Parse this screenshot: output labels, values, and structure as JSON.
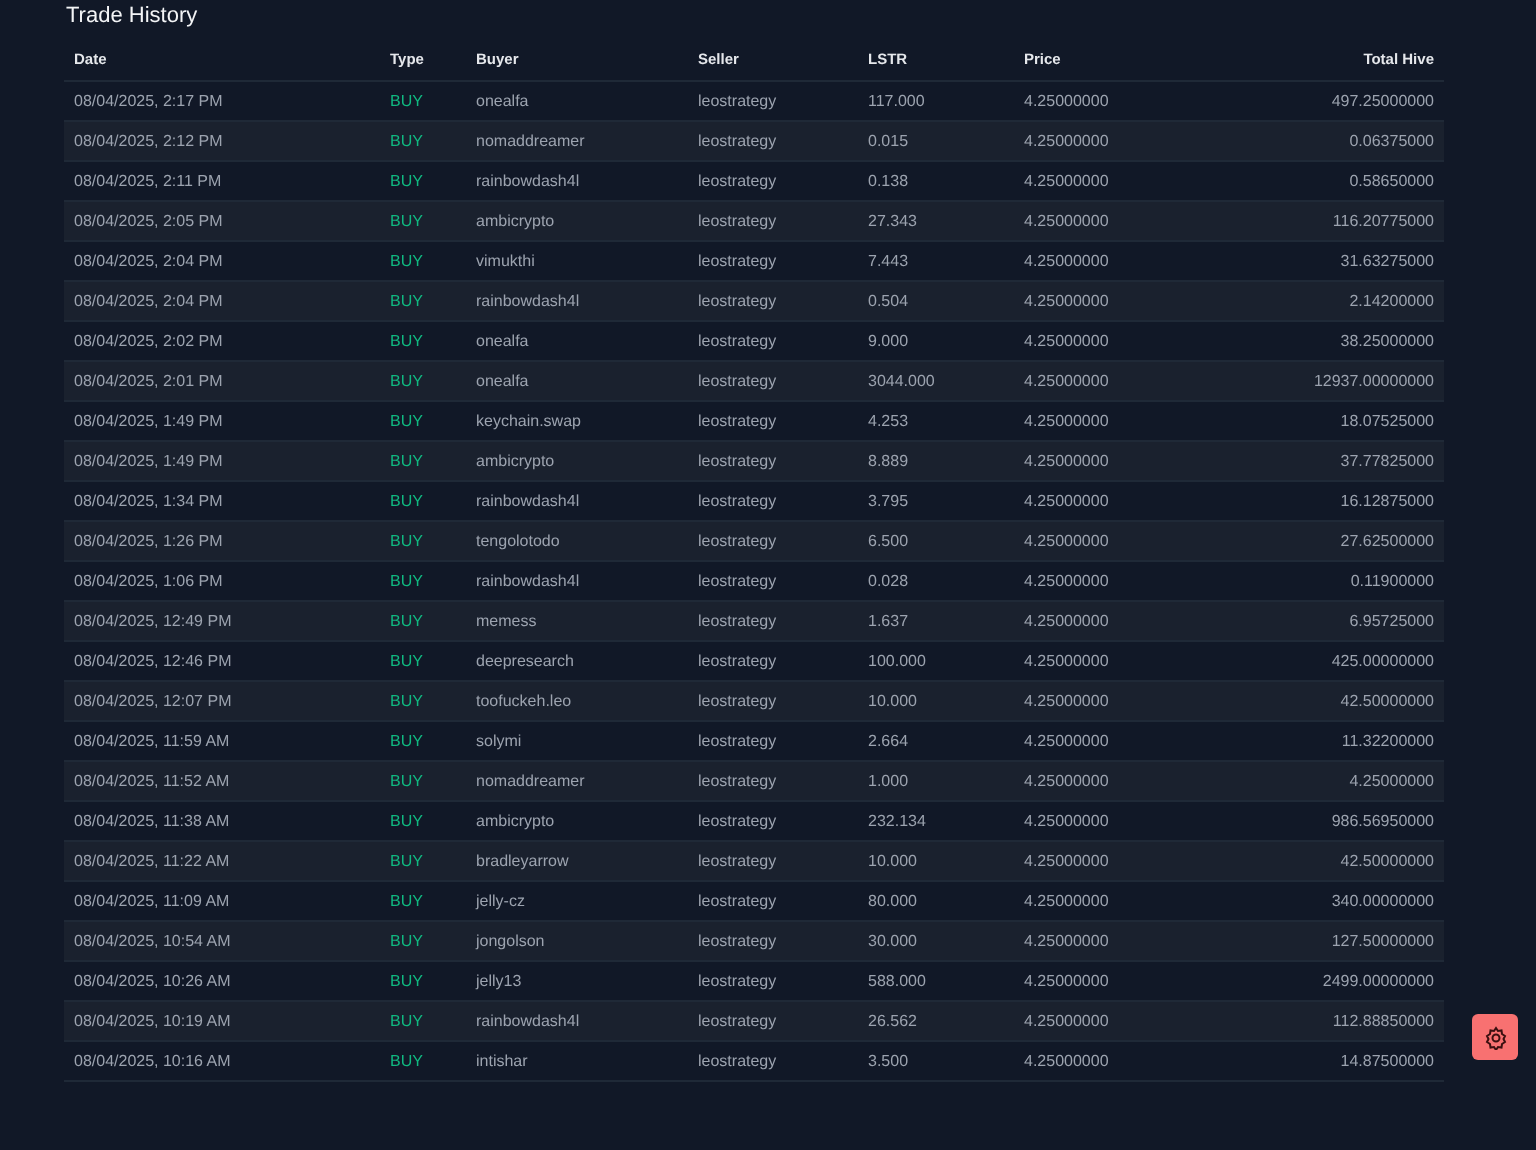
{
  "title": "Trade History",
  "columns": [
    "Date",
    "Type",
    "Buyer",
    "Seller",
    "LSTR",
    "Price",
    "Total Hive"
  ],
  "rows": [
    {
      "kind": "buy",
      "cells": [
        "08/04/2025, 2:17 PM",
        "BUY",
        "onealfa",
        "leostrategy",
        "117.000",
        "4.25000000",
        "497.25000000"
      ]
    },
    {
      "kind": "buy",
      "cells": [
        "08/04/2025, 2:12 PM",
        "BUY",
        "nomaddreamer",
        "leostrategy",
        "0.015",
        "4.25000000",
        "0.06375000"
      ]
    },
    {
      "kind": "buy",
      "cells": [
        "08/04/2025, 2:11 PM",
        "BUY",
        "rainbowdash4l",
        "leostrategy",
        "0.138",
        "4.25000000",
        "0.58650000"
      ]
    },
    {
      "kind": "buy",
      "cells": [
        "08/04/2025, 2:05 PM",
        "BUY",
        "ambicrypto",
        "leostrategy",
        "27.343",
        "4.25000000",
        "116.20775000"
      ]
    },
    {
      "kind": "buy",
      "cells": [
        "08/04/2025, 2:04 PM",
        "BUY",
        "vimukthi",
        "leostrategy",
        "7.443",
        "4.25000000",
        "31.63275000"
      ]
    },
    {
      "kind": "buy",
      "cells": [
        "08/04/2025, 2:04 PM",
        "BUY",
        "rainbowdash4l",
        "leostrategy",
        "0.504",
        "4.25000000",
        "2.14200000"
      ]
    },
    {
      "kind": "buy",
      "cells": [
        "08/04/2025, 2:02 PM",
        "BUY",
        "onealfa",
        "leostrategy",
        "9.000",
        "4.25000000",
        "38.25000000"
      ]
    },
    {
      "kind": "buy",
      "cells": [
        "08/04/2025, 2:01 PM",
        "BUY",
        "onealfa",
        "leostrategy",
        "3044.000",
        "4.25000000",
        "12937.00000000"
      ]
    },
    {
      "kind": "buy",
      "cells": [
        "08/04/2025, 1:49 PM",
        "BUY",
        "keychain.swap",
        "leostrategy",
        "4.253",
        "4.25000000",
        "18.07525000"
      ]
    },
    {
      "kind": "buy",
      "cells": [
        "08/04/2025, 1:49 PM",
        "BUY",
        "ambicrypto",
        "leostrategy",
        "8.889",
        "4.25000000",
        "37.77825000"
      ]
    },
    {
      "kind": "buy",
      "cells": [
        "08/04/2025, 1:34 PM",
        "BUY",
        "rainbowdash4l",
        "leostrategy",
        "3.795",
        "4.25000000",
        "16.12875000"
      ]
    },
    {
      "kind": "buy",
      "cells": [
        "08/04/2025, 1:26 PM",
        "BUY",
        "tengolotodo",
        "leostrategy",
        "6.500",
        "4.25000000",
        "27.62500000"
      ]
    },
    {
      "kind": "buy",
      "cells": [
        "08/04/2025, 1:06 PM",
        "BUY",
        "rainbowdash4l",
        "leostrategy",
        "0.028",
        "4.25000000",
        "0.11900000"
      ]
    },
    {
      "kind": "buy",
      "cells": [
        "08/04/2025, 12:49 PM",
        "BUY",
        "memess",
        "leostrategy",
        "1.637",
        "4.25000000",
        "6.95725000"
      ]
    },
    {
      "kind": "buy",
      "cells": [
        "08/04/2025, 12:46 PM",
        "BUY",
        "deepresearch",
        "leostrategy",
        "100.000",
        "4.25000000",
        "425.00000000"
      ]
    },
    {
      "kind": "buy",
      "cells": [
        "08/04/2025, 12:07 PM",
        "BUY",
        "toofuckeh.leo",
        "leostrategy",
        "10.000",
        "4.25000000",
        "42.50000000"
      ]
    },
    {
      "kind": "buy",
      "cells": [
        "08/04/2025, 11:59 AM",
        "BUY",
        "solymi",
        "leostrategy",
        "2.664",
        "4.25000000",
        "11.32200000"
      ]
    },
    {
      "kind": "buy",
      "cells": [
        "08/04/2025, 11:52 AM",
        "BUY",
        "nomaddreamer",
        "leostrategy",
        "1.000",
        "4.25000000",
        "4.25000000"
      ]
    },
    {
      "kind": "buy",
      "cells": [
        "08/04/2025, 11:38 AM",
        "BUY",
        "ambicrypto",
        "leostrategy",
        "232.134",
        "4.25000000",
        "986.56950000"
      ]
    },
    {
      "kind": "buy",
      "cells": [
        "08/04/2025, 11:22 AM",
        "BUY",
        "bradleyarrow",
        "leostrategy",
        "10.000",
        "4.25000000",
        "42.50000000"
      ]
    },
    {
      "kind": "buy",
      "cells": [
        "08/04/2025, 11:09 AM",
        "BUY",
        "jelly-cz",
        "leostrategy",
        "80.000",
        "4.25000000",
        "340.00000000"
      ]
    },
    {
      "kind": "buy",
      "cells": [
        "08/04/2025, 10:54 AM",
        "BUY",
        "jongolson",
        "leostrategy",
        "30.000",
        "4.25000000",
        "127.50000000"
      ]
    },
    {
      "kind": "buy",
      "cells": [
        "08/04/2025, 10:26 AM",
        "BUY",
        "jelly13",
        "leostrategy",
        "588.000",
        "4.25000000",
        "2499.00000000"
      ]
    },
    {
      "kind": "buy",
      "cells": [
        "08/04/2025, 10:19 AM",
        "BUY",
        "rainbowdash4l",
        "leostrategy",
        "26.562",
        "4.25000000",
        "112.88850000"
      ]
    },
    {
      "kind": "buy",
      "cells": [
        "08/04/2025, 10:16 AM",
        "BUY",
        "intishar",
        "leostrategy",
        "3.500",
        "4.25000000",
        "14.87500000"
      ]
    }
  ]
}
